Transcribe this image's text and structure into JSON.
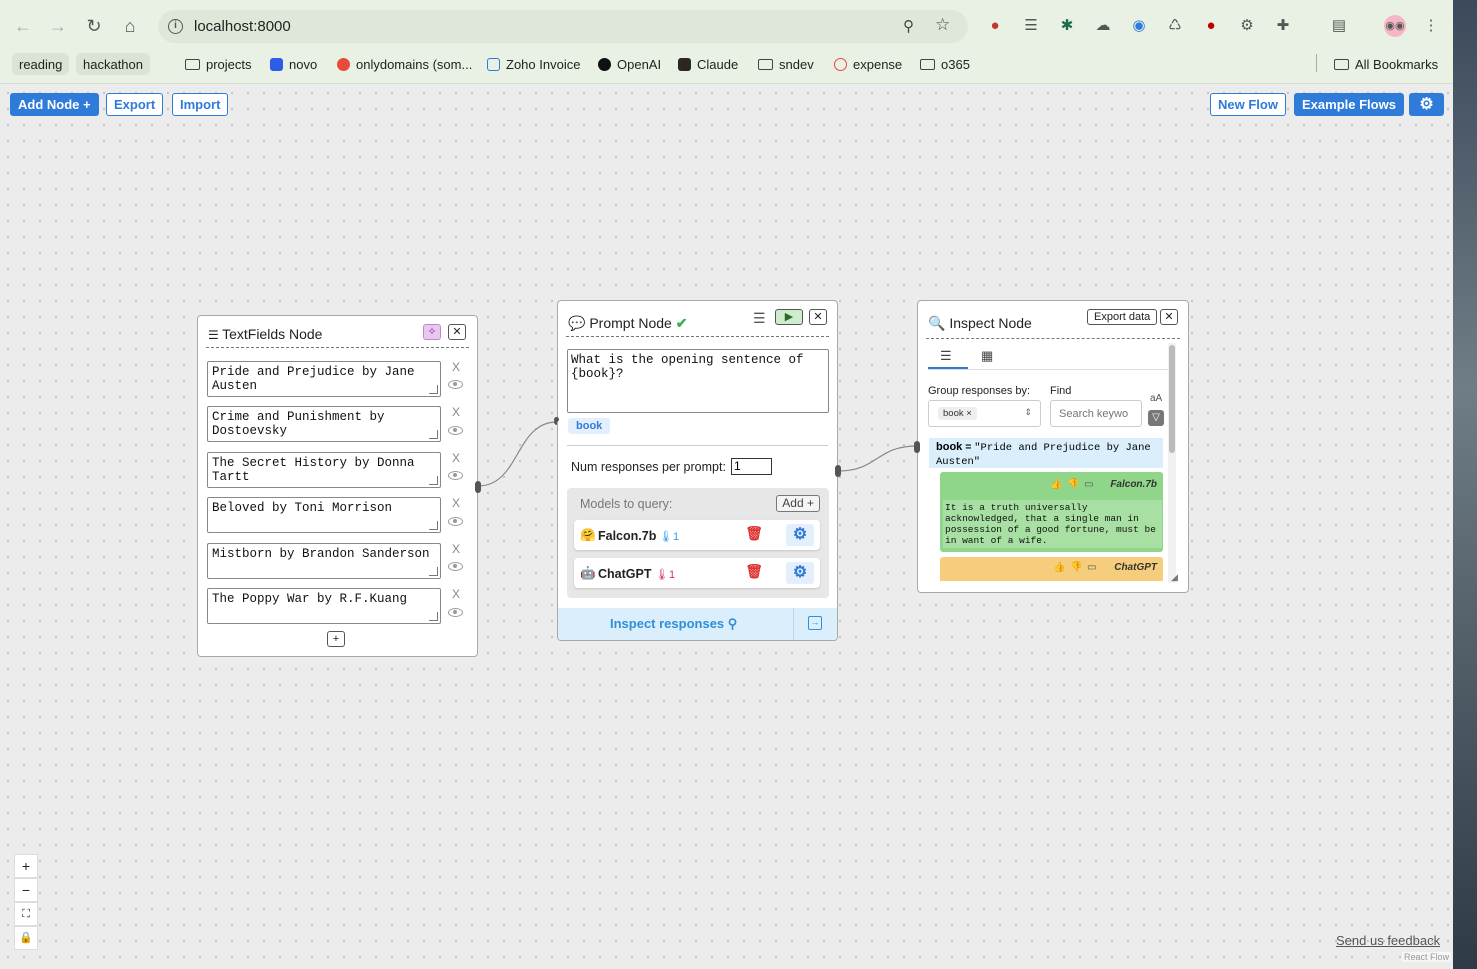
{
  "browser": {
    "url": "localhost:8000",
    "bookmarks": [
      "reading",
      "hackathon",
      "projects",
      "novo",
      "onlydomains (som...",
      "Zoho Invoice",
      "OpenAI",
      "Claude",
      "sndev",
      "expense",
      "o365"
    ],
    "all_bookmarks": "All Bookmarks"
  },
  "toolbar": {
    "add_node": "Add Node +",
    "export": "Export",
    "import": "Import",
    "new_flow": "New Flow",
    "example_flows": "Example Flows"
  },
  "textfields_node": {
    "title": "TextFields Node",
    "fields": [
      "Pride and Prejudice by Jane Austen",
      "Crime and Punishment by Dostoevsky",
      "The Secret History by Donna Tartt",
      "Beloved by Toni Morrison",
      "Mistborn by Brandon Sanderson",
      "The Poppy War by R.F.Kuang"
    ],
    "remove_label": "X",
    "add_label": "+"
  },
  "prompt_node": {
    "title": "Prompt Node",
    "status_check": "✔",
    "prompt_text": "What is the opening sentence of {book}?",
    "template_var": "book",
    "num_responses_label": "Num responses per prompt:",
    "num_responses_value": "1",
    "models_label": "Models to query:",
    "add_model_label": "Add +",
    "models": [
      {
        "name": "Falcon.7b",
        "temp": "1",
        "emoji": "🤗"
      },
      {
        "name": "ChatGPT",
        "temp": "1",
        "emoji": "🤖"
      }
    ],
    "inspect_label": "Inspect responses"
  },
  "inspect_node": {
    "title": "Inspect Node",
    "export_label": "Export data",
    "group_label": "Group responses by:",
    "find_label": "Find",
    "group_tag": "book",
    "search_placeholder": "Search keywo",
    "group_var_name": "book",
    "group_var_eq": " = ",
    "group_var_value": "\"Pride and Prejudice by Jane Austen\"",
    "responses": [
      {
        "model": "Falcon.7b",
        "text": "It is a truth universally acknowledged, that a single man in possession of a good fortune, must be in want of a wife.",
        "color": "#8fd68a"
      },
      {
        "model": "ChatGPT",
        "text": "",
        "color": "#f6cd7c"
      }
    ]
  },
  "footer": {
    "feedback": "Send us feedback",
    "attribution": "React Flow"
  },
  "colors": {
    "accent": "#2f7bd9"
  }
}
